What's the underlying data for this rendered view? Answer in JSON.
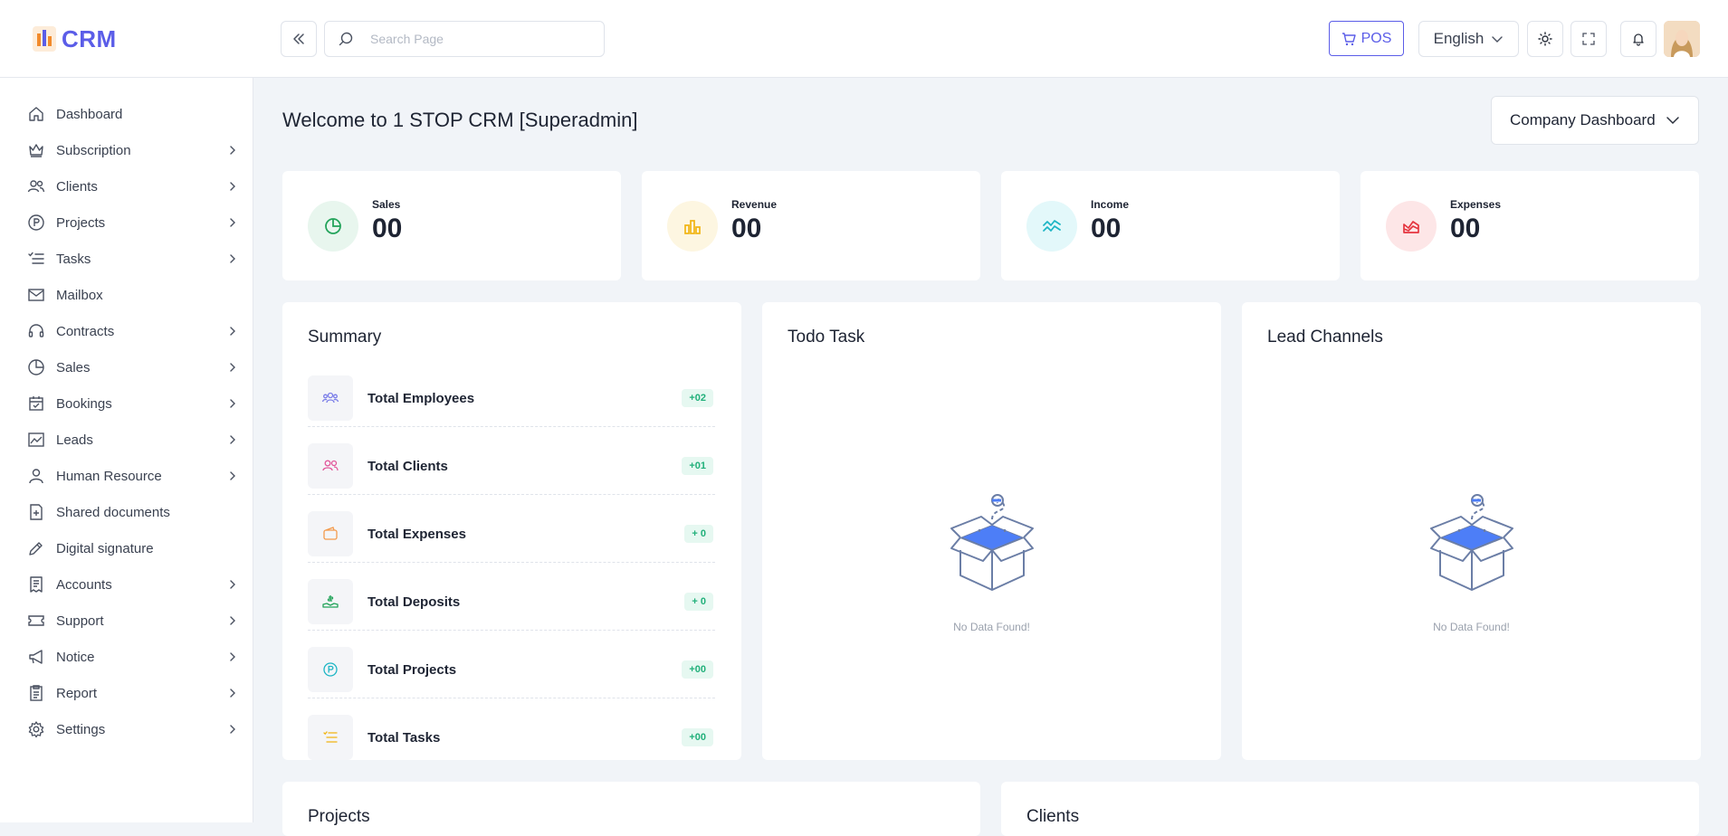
{
  "brand": {
    "name": "CRM"
  },
  "topbar": {
    "search_placeholder": "Search Page",
    "pos_label": "POS",
    "language": "English"
  },
  "sidebar": {
    "items": [
      {
        "label": "Dashboard",
        "icon": "home-icon",
        "has_children": false
      },
      {
        "label": "Subscription",
        "icon": "crown-icon",
        "has_children": true
      },
      {
        "label": "Clients",
        "icon": "users-icon",
        "has_children": true
      },
      {
        "label": "Projects",
        "icon": "p-circle-icon",
        "has_children": true
      },
      {
        "label": "Tasks",
        "icon": "task-list-icon",
        "has_children": true
      },
      {
        "label": "Mailbox",
        "icon": "mail-icon",
        "has_children": false
      },
      {
        "label": "Contracts",
        "icon": "headset-icon",
        "has_children": true
      },
      {
        "label": "Sales",
        "icon": "pie-chart-icon",
        "has_children": true
      },
      {
        "label": "Bookings",
        "icon": "calendar-check-icon",
        "has_children": true
      },
      {
        "label": "Leads",
        "icon": "image-chart-icon",
        "has_children": true
      },
      {
        "label": "Human Resource",
        "icon": "person-icon",
        "has_children": true
      },
      {
        "label": "Shared documents",
        "icon": "document-plus-icon",
        "has_children": false
      },
      {
        "label": "Digital signature",
        "icon": "pen-icon",
        "has_children": false
      },
      {
        "label": "Accounts",
        "icon": "receipt-icon",
        "has_children": true
      },
      {
        "label": "Support",
        "icon": "ticket-icon",
        "has_children": true
      },
      {
        "label": "Notice",
        "icon": "megaphone-icon",
        "has_children": true
      },
      {
        "label": "Report",
        "icon": "clipboard-icon",
        "has_children": true
      },
      {
        "label": "Settings",
        "icon": "gear-icon",
        "has_children": true
      }
    ]
  },
  "main": {
    "welcome": "Welcome to 1 STOP CRM [Superadmin]",
    "dashboard_select": "Company Dashboard",
    "stats": [
      {
        "label": "Sales",
        "value": "00",
        "icon": "pie-chart-icon",
        "color": "#22a35a",
        "bg": "#e8f6ee"
      },
      {
        "label": "Revenue",
        "value": "00",
        "icon": "bar-chart-icon",
        "color": "#f1b512",
        "bg": "#fdf6e1"
      },
      {
        "label": "Income",
        "value": "00",
        "icon": "wave-chart-icon",
        "color": "#1cb5c4",
        "bg": "#e3f8fa"
      },
      {
        "label": "Expenses",
        "value": "00",
        "icon": "area-chart-icon",
        "color": "#e5353f",
        "bg": "#fde6e7"
      }
    ],
    "summary": {
      "title": "Summary",
      "rows": [
        {
          "label": "Total Employees",
          "badge": "+02",
          "icon": "team-icon",
          "color": "#7a7de8"
        },
        {
          "label": "Total Clients",
          "badge": "+01",
          "icon": "users-icon",
          "color": "#e2589b"
        },
        {
          "label": "Total Expenses",
          "badge": "+ 0",
          "icon": "wallet-icon",
          "color": "#f39a4c"
        },
        {
          "label": "Total Deposits",
          "badge": "+ 0",
          "icon": "deposit-icon",
          "color": "#22a35a"
        },
        {
          "label": "Total Projects",
          "badge": "+00",
          "icon": "p-circle-icon",
          "color": "#1cb5c4"
        },
        {
          "label": "Total Tasks",
          "badge": "+00",
          "icon": "task-list-icon",
          "color": "#f1b512"
        }
      ]
    },
    "todo": {
      "title": "Todo Task",
      "empty": "No Data Found!"
    },
    "lead_channels": {
      "title": "Lead Channels",
      "empty": "No Data Found!"
    },
    "bottom": {
      "projects_title": "Projects",
      "clients_title": "Clients"
    }
  }
}
